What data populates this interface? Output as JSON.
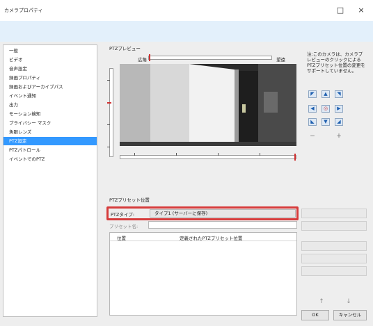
{
  "window": {
    "title": "カメラプロパティ",
    "minimize_glyph": "□",
    "close_glyph": "×"
  },
  "sidebar": {
    "items": [
      {
        "label": "一般",
        "selected": false
      },
      {
        "label": "ビデオ",
        "selected": false
      },
      {
        "label": "音声設定",
        "selected": false
      },
      {
        "label": "録画プロパティ",
        "selected": false
      },
      {
        "label": "録画およびアーカイブパス",
        "selected": false
      },
      {
        "label": "イベント通知",
        "selected": false
      },
      {
        "label": "出力",
        "selected": false
      },
      {
        "label": "モーション検知",
        "selected": false
      },
      {
        "label": "プライバシー マスク",
        "selected": false
      },
      {
        "label": "魚眼レンズ",
        "selected": false
      },
      {
        "label": "PTZ設定",
        "selected": true
      },
      {
        "label": "PTZパトロール",
        "selected": false
      },
      {
        "label": "イベントでのPTZ",
        "selected": false
      }
    ]
  },
  "preview": {
    "section_label": "PTZプレビュー",
    "zoom_wide": "広角",
    "zoom_tele": "望遠"
  },
  "hint_text": "注:このカメラは、カメラプレビューのクリックによるPTZプリセット位置の変更をサポートしていません。",
  "controls": {
    "pan_up": "▲",
    "pan_down": "▼",
    "pan_left": "◀",
    "pan_right": "▶",
    "pan_up_left": "◤",
    "pan_up_right": "◥",
    "pan_down_left": "◣",
    "pan_down_right": "◢",
    "home": "◎",
    "zoom_out": "－",
    "zoom_in": "＋"
  },
  "preset": {
    "section_label": "PTZプリセット位置",
    "type_label": "PTZタイプ:",
    "type_value": "タイプ1 (サーバーに保存)",
    "name_label": "プリセット名:"
  },
  "table": {
    "columns": [
      "位置",
      "定義されたPTZプリセット位置"
    ]
  },
  "buttons": {
    "ok": "OK",
    "cancel": "キャンセル",
    "move_up": "↑",
    "move_down": "↓"
  },
  "colors": {
    "selection": "#3399ff",
    "highlight": "#d63b3b",
    "band": "#e3f0fb"
  }
}
